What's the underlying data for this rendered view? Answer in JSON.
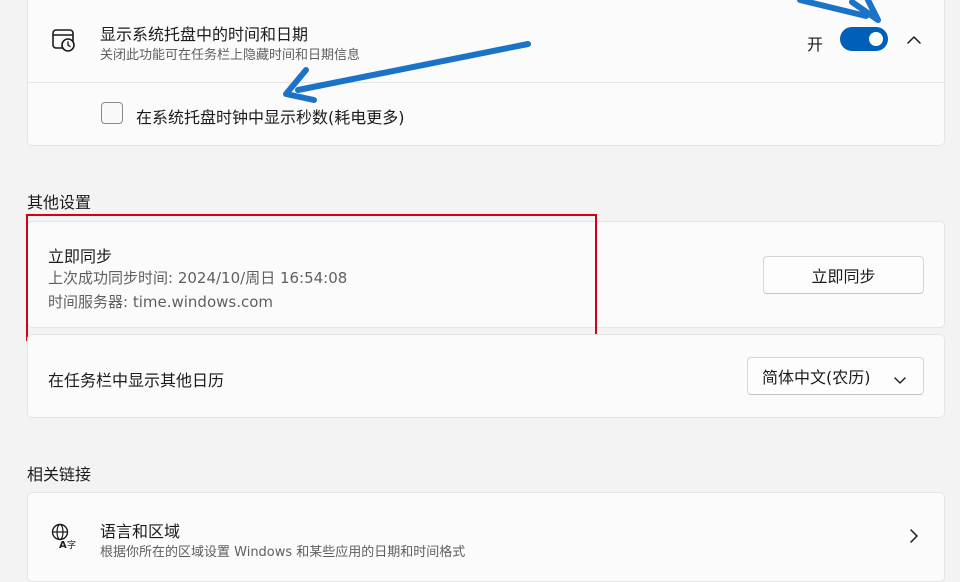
{
  "clock_section": {
    "title": "显示系统托盘中的时间和日期",
    "description": "关闭此功能可在任务栏上隐藏时间和日期信息",
    "toggle_state": "开",
    "seconds_option": "在系统托盘时钟中显示秒数(耗电更多)"
  },
  "other_settings": {
    "header": "其他设置",
    "sync": {
      "title": "立即同步",
      "last_sync": "上次成功同步时间: 2024/10/周日 16:54:08",
      "server": "时间服务器: time.windows.com",
      "button_label": "立即同步"
    },
    "calendar": {
      "label": "在任务栏中显示其他日历",
      "selected": "简体中文(农历)"
    }
  },
  "related_links": {
    "header": "相关链接",
    "language_region": {
      "title": "语言和区域",
      "description": "根据你所在的区域设置 Windows 和某些应用的日期和时间格式"
    }
  },
  "colors": {
    "accent": "#005fb8",
    "highlight_box": "#d0021b",
    "annotation_arrow": "#1a73c8"
  }
}
